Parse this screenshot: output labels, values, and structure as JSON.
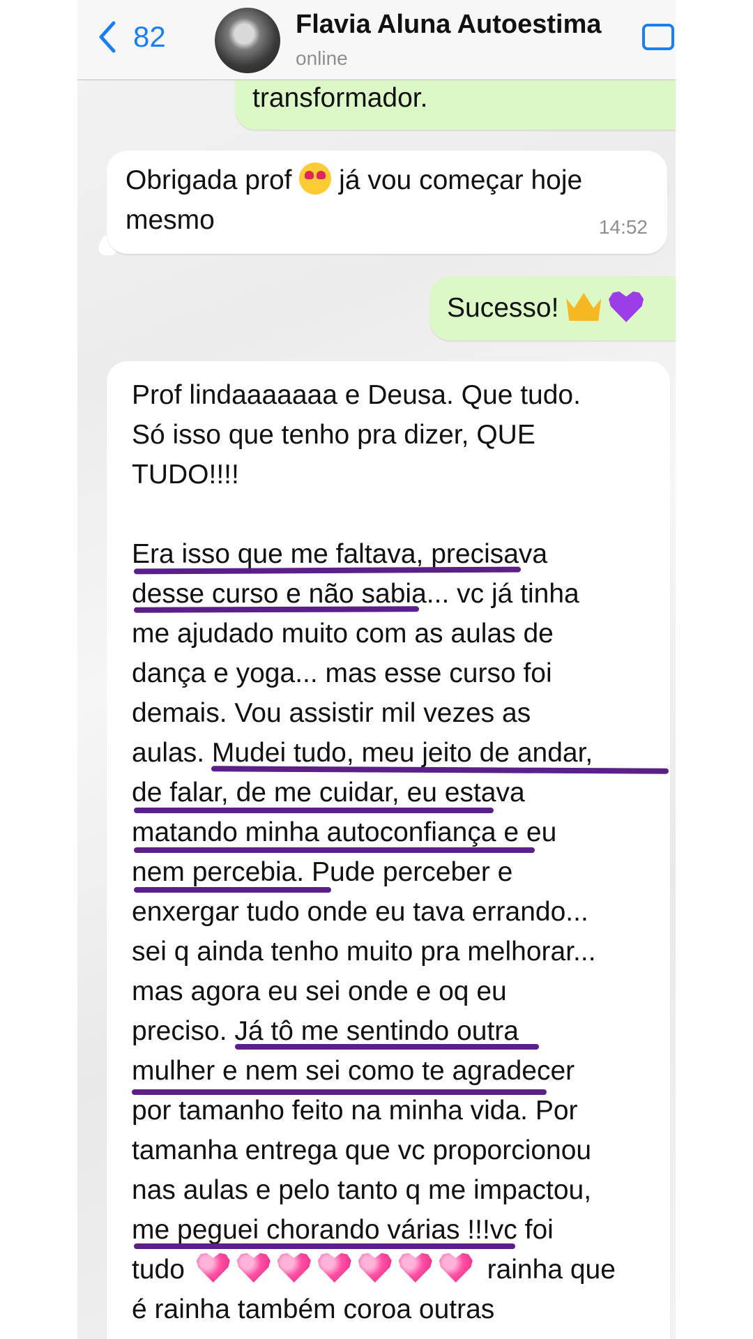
{
  "header": {
    "back_count": "82",
    "contact_name": "Flavia Aluna Autoestima",
    "status": "online"
  },
  "messages": {
    "outgoing_1": "transformador.",
    "incoming_1": {
      "line1_a": "Obrigada prof",
      "line1_b": "já vou começar hoje",
      "line2": "mesmo",
      "time": "14:52"
    },
    "outgoing_2": "Sucesso!",
    "incoming_2": {
      "lines": [
        "Prof lindaaaaaaa e Deusa. Que tudo.",
        "Só isso que tenho pra dizer, QUE",
        "TUDO!!!!",
        "",
        "Era isso que me faltava, precisava",
        "desse curso e não sabia... vc já tinha",
        "me ajudado muito com as aulas de",
        "dança e yoga... mas esse curso foi",
        "demais. Vou assistir mil vezes as",
        "aulas. Mudei tudo, meu jeito de andar,",
        "de falar, de me cuidar, eu estava",
        "matando minha autoconfiança e eu",
        "nem percebia. Pude perceber e",
        "enxergar tudo onde eu tava errando...",
        "sei q ainda tenho muito pra melhorar...",
        "mas agora eu sei onde e oq eu",
        "preciso. Já tô me sentindo outra",
        "mulher e nem sei como te agradecer",
        "por tamanho feito na minha vida. Por",
        "tamanha entrega que vc proporcionou",
        "nas aulas e pelo tanto q me impactou,",
        "me peguei chorando várias !!!vc foi"
      ],
      "line_tudo": "tudo",
      "line_rainha": "rainha que",
      "line_last": "é rainha também coroa outras"
    }
  },
  "icons": {
    "back": "chevron-left-icon",
    "video": "video-call-icon",
    "heart_emoji": "sparkling-heart-icon",
    "eyes_emoji": "heart-eyes-face-icon",
    "crown_emoji": "crown-icon",
    "purple_heart_emoji": "purple-heart-icon"
  },
  "colors": {
    "accent": "#1a7ff5",
    "outgoing_bubble": "#dcf8c6",
    "incoming_bubble": "#ffffff",
    "underline": "#5a1f88"
  }
}
